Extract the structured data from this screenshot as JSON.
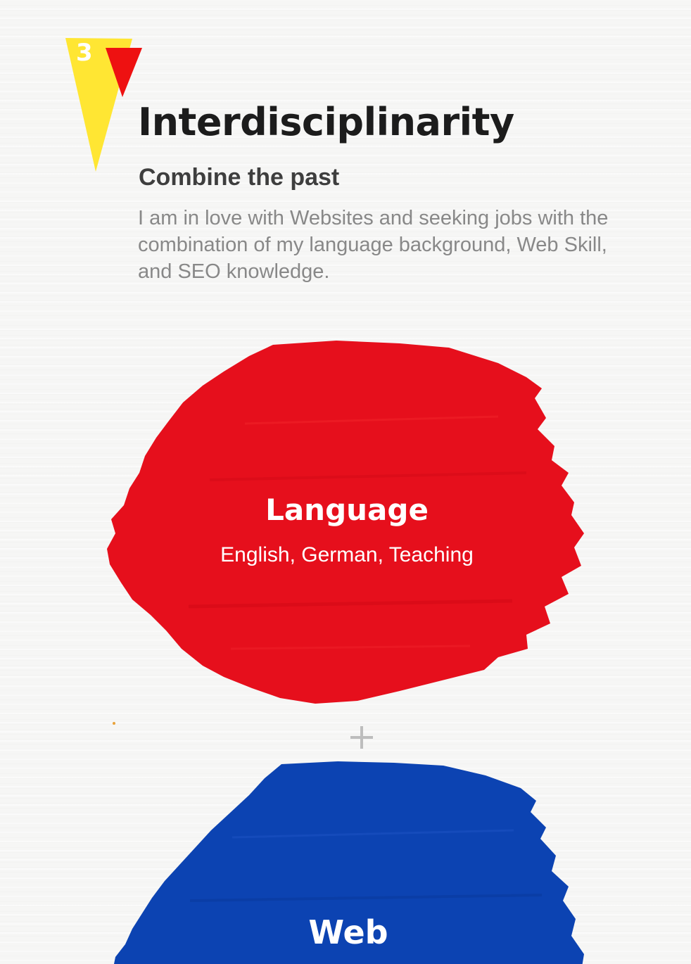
{
  "section": {
    "number": "3",
    "title": "Interdisciplinarity",
    "subtitle": "Combine the past",
    "description": "I am in love with Websites and seeking jobs with the combination of my language background, Web Skill, and SEO knowledge."
  },
  "skills": [
    {
      "title": "Language",
      "description": "English, German, Teaching",
      "color": "#e60f1c"
    },
    {
      "title": "Web",
      "color": "#0c43b2"
    }
  ],
  "separator_icon": "plus-icon",
  "colors": {
    "badge_yellow": "#ffe633",
    "badge_red": "#ee1111",
    "title": "#1c1c1c",
    "subtitle": "#3e3e3e",
    "body_text": "#888888",
    "plus": "#bdbdbd"
  }
}
